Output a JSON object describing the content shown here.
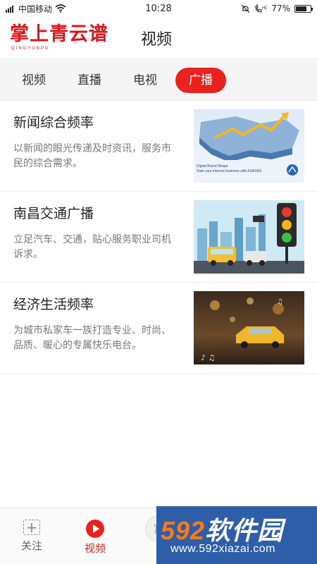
{
  "status_bar": {
    "carrier": "中国移动",
    "time": "10:28",
    "battery": "77%",
    "battery_level": 0.77,
    "icons": [
      "signal-icon",
      "wifi-icon",
      "mute-icon",
      "hd-call-icon",
      "battery-icon"
    ]
  },
  "header": {
    "logo_text": "掌上青云谱",
    "logo_sub": "QINGYUNPU",
    "title": "视频"
  },
  "tabs": [
    {
      "label": "视频",
      "active": false
    },
    {
      "label": "直播",
      "active": false
    },
    {
      "label": "电视",
      "active": false
    },
    {
      "label": "广播",
      "active": true
    }
  ],
  "channels": [
    {
      "title": "新闻综合频率",
      "desc": "以新闻的眼光传递及时资讯，服务市民的综合需求。",
      "image": "business-map-chart-image"
    },
    {
      "title": "南昌交通广播",
      "desc": "立足汽车、交通，贴心服务职业司机诉求。",
      "image": "traffic-light-city-image"
    },
    {
      "title": "经济生活频率",
      "desc": "为城市私家车一族打造专业、时尚、品质、暖心的专属快乐电台。",
      "image": "rainy-taxi-music-image"
    }
  ],
  "bottom_nav": [
    {
      "label": "关注",
      "icon": "plus-box-icon",
      "active": false
    },
    {
      "label": "视频",
      "icon": "play-circle-icon",
      "active": true
    },
    {
      "label": "富",
      "icon": "center-circle-icon",
      "active": false
    }
  ],
  "watermark": {
    "brand_num": "592",
    "brand_text": "软件园",
    "url": "www.592xiazai.com"
  },
  "colors": {
    "accent": "#e8231e",
    "logo": "#d9161c",
    "tab_bar_bg": "#f5f5f5",
    "watermark_bg": "#2f5ea8"
  }
}
